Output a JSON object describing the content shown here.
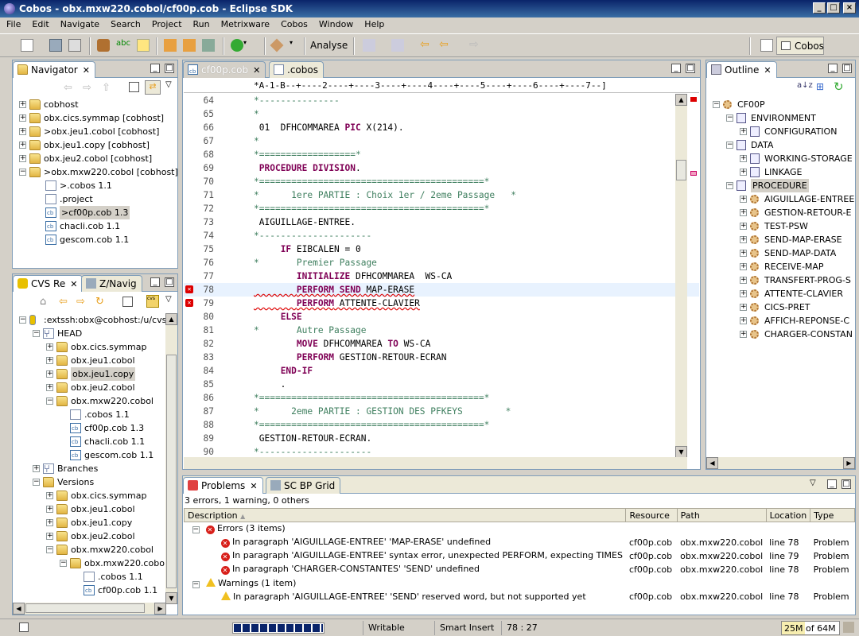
{
  "window": {
    "title": "Cobos - obx.mxw220.cobol/cf00p.cob - Eclipse SDK"
  },
  "menu": [
    "File",
    "Edit",
    "Navigate",
    "Search",
    "Project",
    "Run",
    "Metrixware",
    "Cobos",
    "Window",
    "Help"
  ],
  "toolbar": {
    "analyse_label": "Analyse",
    "perspective_label": "Cobos"
  },
  "navigator": {
    "title": "Navigator",
    "items": [
      {
        "label": "cobhost",
        "kind": "folder",
        "depth": 0
      },
      {
        "label": "obx.cics.symmap   [cobhost]",
        "kind": "folder",
        "depth": 0
      },
      {
        "label": ">obx.jeu1.cobol   [cobhost]",
        "kind": "folder",
        "depth": 0
      },
      {
        "label": "obx.jeu1.copy   [cobhost]",
        "kind": "folder",
        "depth": 0
      },
      {
        "label": "obx.jeu2.cobol   [cobhost]",
        "kind": "folder",
        "depth": 0
      },
      {
        "label": ">obx.mxw220.cobol   [cobhost]",
        "kind": "folder",
        "depth": 0
      },
      {
        "label": ">.cobos  1.1",
        "kind": "file",
        "depth": 1
      },
      {
        "label": ".project",
        "kind": "file",
        "depth": 1
      },
      {
        "label": ">cf00p.cob  1.3",
        "kind": "cob",
        "depth": 1
      },
      {
        "label": "chacli.cob  1.1",
        "kind": "cob",
        "depth": 1
      },
      {
        "label": "gescom.cob  1.1",
        "kind": "cob",
        "depth": 1
      }
    ]
  },
  "cvs": {
    "tab1": "CVS Re",
    "tab2": "Z/Navig",
    "items": [
      {
        "label": ":extssh:obx@cobhost:/u/cvsa",
        "kind": "repo",
        "depth": 0
      },
      {
        "label": "HEAD",
        "kind": "branch",
        "depth": 1
      },
      {
        "label": "obx.cics.symmap",
        "kind": "folder",
        "depth": 2
      },
      {
        "label": "obx.jeu1.cobol",
        "kind": "folder",
        "depth": 2
      },
      {
        "label": "obx.jeu1.copy",
        "kind": "folder",
        "depth": 2
      },
      {
        "label": "obx.jeu2.cobol",
        "kind": "folder",
        "depth": 2
      },
      {
        "label": "obx.mxw220.cobol",
        "kind": "folder",
        "depth": 2
      },
      {
        "label": ".cobos 1.1",
        "kind": "file",
        "depth": 3
      },
      {
        "label": "cf00p.cob 1.3",
        "kind": "cob",
        "depth": 3
      },
      {
        "label": "chacli.cob 1.1",
        "kind": "cob",
        "depth": 3
      },
      {
        "label": "gescom.cob 1.1",
        "kind": "cob",
        "depth": 3
      },
      {
        "label": "Branches",
        "kind": "branch",
        "depth": 1
      },
      {
        "label": "Versions",
        "kind": "folder",
        "depth": 1
      },
      {
        "label": "obx.cics.symmap",
        "kind": "folder",
        "depth": 2
      },
      {
        "label": "obx.jeu1.cobol",
        "kind": "folder",
        "depth": 2
      },
      {
        "label": "obx.jeu1.copy",
        "kind": "folder",
        "depth": 2
      },
      {
        "label": "obx.jeu2.cobol",
        "kind": "folder",
        "depth": 2
      },
      {
        "label": "obx.mxw220.cobol",
        "kind": "folder",
        "depth": 2
      },
      {
        "label": "obx.mxw220.cobo",
        "kind": "folder",
        "depth": 3
      },
      {
        "label": ".cobos 1.1",
        "kind": "file",
        "depth": 4
      },
      {
        "label": "cf00p.cob 1.1",
        "kind": "cob",
        "depth": 4
      }
    ]
  },
  "editor": {
    "tabs": [
      {
        "label": "cf00p.cob",
        "active": true
      },
      {
        "label": ".cobos",
        "active": false
      }
    ],
    "ruler": "*A-1-B--+----2----+----3----+----4----+----5----+----6----+----7--]",
    "lines": [
      {
        "n": "64",
        "text": "*---------------",
        "type": "comment"
      },
      {
        "n": "65",
        "text": "*",
        "type": "comment"
      },
      {
        "n": "66",
        "text": " 01  DFHCOMMAREA PIC X(214).",
        "type": "data"
      },
      {
        "n": "67",
        "text": "*",
        "type": "comment"
      },
      {
        "n": "68",
        "text": "*==================*",
        "type": "comment"
      },
      {
        "n": "69",
        "text": " PROCEDURE DIVISION.",
        "type": "keyword"
      },
      {
        "n": "70",
        "text": "*==========================================*",
        "type": "comment"
      },
      {
        "n": "71",
        "text": "*      1ere PARTIE : Choix 1er / 2eme Passage   *",
        "type": "comment"
      },
      {
        "n": "72",
        "text": "*==========================================*",
        "type": "comment"
      },
      {
        "n": "73",
        "text": " AIGUILLAGE-ENTREE.",
        "type": "plain"
      },
      {
        "n": "74",
        "text": "*---------------------",
        "type": "comment"
      },
      {
        "n": "75",
        "text": "     IF EIBCALEN = 0",
        "type": "if"
      },
      {
        "n": "76",
        "text": "*       Premier Passage",
        "type": "comment"
      },
      {
        "n": "77",
        "text": "        INITIALIZE DFHCOMMAREA  WS-CA",
        "type": "init"
      },
      {
        "n": "78",
        "text": "        PERFORM SEND MAP-ERASE",
        "type": "perform-err"
      },
      {
        "n": "79",
        "text": "        PERFORM ATTENTE-CLAVIER",
        "type": "perform-err2"
      },
      {
        "n": "80",
        "text": "     ELSE",
        "type": "keyword-indent"
      },
      {
        "n": "81",
        "text": "*       Autre Passage",
        "type": "comment"
      },
      {
        "n": "82",
        "text": "        MOVE DFHCOMMAREA TO WS-CA",
        "type": "move"
      },
      {
        "n": "83",
        "text": "        PERFORM GESTION-RETOUR-ECRAN",
        "type": "perform"
      },
      {
        "n": "84",
        "text": "     END-IF",
        "type": "keyword-indent"
      },
      {
        "n": "85",
        "text": "     .",
        "type": "plain"
      },
      {
        "n": "86",
        "text": "*==========================================*",
        "type": "comment"
      },
      {
        "n": "87",
        "text": "*      2eme PARTIE : GESTION DES PFKEYS        *",
        "type": "comment"
      },
      {
        "n": "88",
        "text": "*==========================================*",
        "type": "comment"
      },
      {
        "n": "89",
        "text": " GESTION-RETOUR-ECRAN.",
        "type": "plain"
      },
      {
        "n": "90",
        "text": "*---------------------",
        "type": "comment"
      }
    ]
  },
  "outline": {
    "title": "Outline",
    "items": [
      {
        "label": "CF00P",
        "kind": "gear",
        "depth": 0
      },
      {
        "label": "ENVIRONMENT",
        "kind": "section",
        "depth": 1
      },
      {
        "label": "CONFIGURATION",
        "kind": "section",
        "depth": 2
      },
      {
        "label": "DATA",
        "kind": "section",
        "depth": 1
      },
      {
        "label": "WORKING-STORAGE",
        "kind": "section",
        "depth": 2
      },
      {
        "label": "LINKAGE",
        "kind": "section",
        "depth": 2
      },
      {
        "label": "PROCEDURE",
        "kind": "section",
        "depth": 1
      },
      {
        "label": "AIGUILLAGE-ENTREE",
        "kind": "gear",
        "depth": 2
      },
      {
        "label": "GESTION-RETOUR-E",
        "kind": "gear",
        "depth": 2
      },
      {
        "label": "TEST-PSW",
        "kind": "gear",
        "depth": 2
      },
      {
        "label": "SEND-MAP-ERASE",
        "kind": "gear",
        "depth": 2
      },
      {
        "label": "SEND-MAP-DATA",
        "kind": "gear",
        "depth": 2
      },
      {
        "label": "RECEIVE-MAP",
        "kind": "gear",
        "depth": 2
      },
      {
        "label": "TRANSFERT-PROG-S",
        "kind": "gear",
        "depth": 2
      },
      {
        "label": "ATTENTE-CLAVIER",
        "kind": "gear",
        "depth": 2
      },
      {
        "label": "CICS-PRET",
        "kind": "gear",
        "depth": 2
      },
      {
        "label": "AFFICH-REPONSE-C",
        "kind": "gear",
        "depth": 2
      },
      {
        "label": "CHARGER-CONSTAN",
        "kind": "gear",
        "depth": 2
      }
    ]
  },
  "problems": {
    "tab1": "Problems",
    "tab2": "SC BP Grid",
    "summary": "3 errors, 1 warning, 0 others",
    "columns": [
      "Description",
      "Resource",
      "Path",
      "Location",
      "Type"
    ],
    "error_group": "Errors (3 items)",
    "warning_group": "Warnings (1 item)",
    "errors": [
      {
        "desc": "In paragraph 'AIGUILLAGE-ENTREE' 'MAP-ERASE' undefined",
        "res": "cf00p.cob",
        "path": "obx.mxw220.cobol",
        "loc": "line 78",
        "type": "Problem"
      },
      {
        "desc": "In paragraph 'AIGUILLAGE-ENTREE' syntax error, unexpected PERFORM, expecting TIMES",
        "res": "cf00p.cob",
        "path": "obx.mxw220.cobol",
        "loc": "line 79",
        "type": "Problem"
      },
      {
        "desc": "In paragraph 'CHARGER-CONSTANTES' 'SEND' undefined",
        "res": "cf00p.cob",
        "path": "obx.mxw220.cobol",
        "loc": "line 78",
        "type": "Problem"
      }
    ],
    "warnings": [
      {
        "desc": "In paragraph 'AIGUILLAGE-ENTREE' 'SEND' reserved word, but not supported yet",
        "res": "cf00p.cob",
        "path": "obx.mxw220.cobol",
        "loc": "line 78",
        "type": "Problem"
      }
    ]
  },
  "status": {
    "writable": "Writable",
    "insert_mode": "Smart Insert",
    "position": "78 : 27",
    "memory": "25M of 64M"
  }
}
